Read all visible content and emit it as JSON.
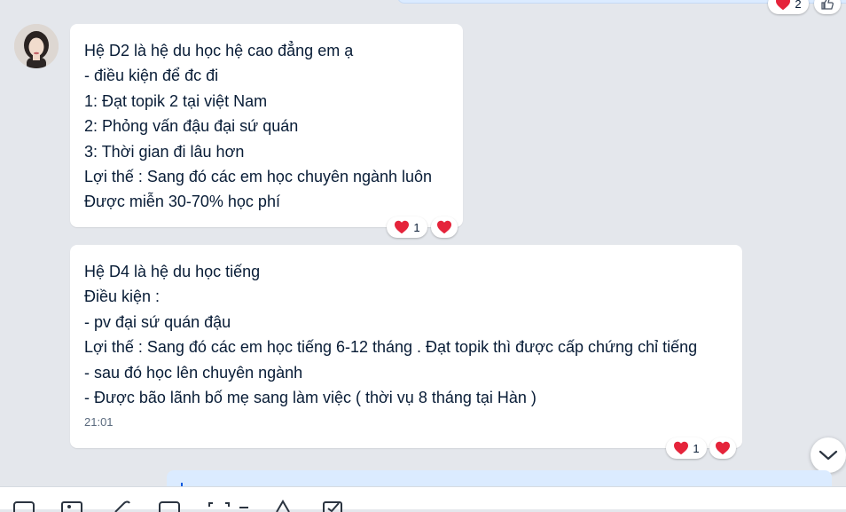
{
  "previous_message": {
    "reaction_count": "2"
  },
  "sender": {
    "avatar": "avatar"
  },
  "messages": [
    {
      "lines": [
        "Hệ D2 là hệ du học hệ cao đẳng em ạ",
        "- điều kiện để đc đi",
        "1: Đạt topik 2 tại việt Nam",
        "2: Phỏng vấn đậu đại sứ quán",
        "3: Thời gian đi lâu hơn",
        "Lợi thế : Sang đó các em học chuyên ngành luôn",
        "Được miễn 30-70% học phí"
      ],
      "reaction_count": "1"
    },
    {
      "lines": [
        "Hệ D4 là hệ du học tiếng",
        "Điều kiện :",
        "- pv đại sứ quán đậu",
        "Lợi thế : Sang đó các em học tiếng 6-12 tháng . Đạt topik thì được cấp chứng chỉ tiếng",
        "- sau đó học lên chuyên ngành",
        "- Được bão lãnh bố mẹ sang làm việc ( thời vụ 8 tháng tại Hàn )"
      ],
      "time": "21:01",
      "reaction_count": "1"
    }
  ],
  "colors": {
    "background": "#e4e7ec",
    "bubble": "#ffffff",
    "own_bubble": "#dbebff",
    "heart": "#e5243b",
    "accent": "#005ae0"
  },
  "icons": [
    "heart-icon",
    "thumbs-up-icon",
    "chevron-down-icon",
    "sticker-icon",
    "image-icon",
    "attachment-icon",
    "card-icon",
    "screenshot-icon",
    "format-icon",
    "checkbox-icon"
  ]
}
